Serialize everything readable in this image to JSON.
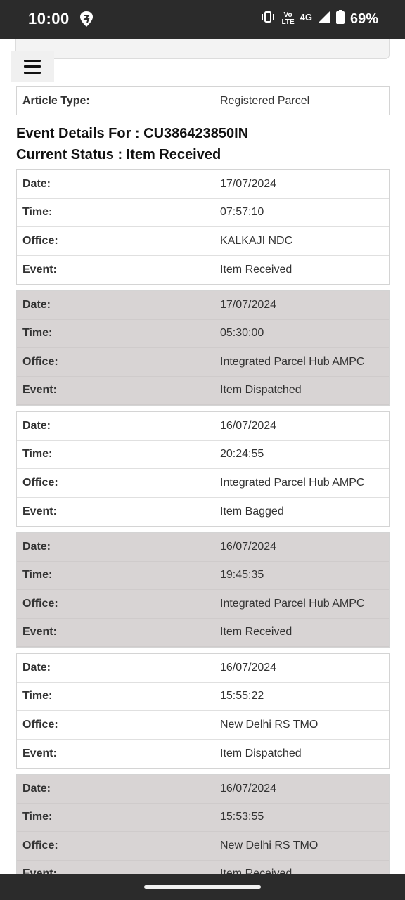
{
  "status_bar": {
    "time": "10:00",
    "app_icon": "swiggy-icon",
    "volte_line1": "Vo",
    "volte_line2": "LTE",
    "network": "4G",
    "battery": "69%"
  },
  "menu": {
    "icon": "hamburger-menu-icon"
  },
  "article": {
    "label": "Article Type:",
    "value": "Registered Parcel"
  },
  "heading": {
    "event_details": "Event Details For : CU386423850IN",
    "current_status": "Current Status : Item Received"
  },
  "labels": {
    "date": "Date:",
    "time": "Time:",
    "office": "Office:",
    "event": "Event:"
  },
  "events": [
    {
      "date": "17/07/2024",
      "time": "07:57:10",
      "office": "KALKAJI NDC",
      "event": "Item Received"
    },
    {
      "date": "17/07/2024",
      "time": "05:30:00",
      "office": "Integrated Parcel Hub AMPC",
      "event": "Item Dispatched"
    },
    {
      "date": "16/07/2024",
      "time": "20:24:55",
      "office": "Integrated Parcel Hub AMPC",
      "event": "Item Bagged"
    },
    {
      "date": "16/07/2024",
      "time": "19:45:35",
      "office": "Integrated Parcel Hub AMPC",
      "event": "Item Received"
    },
    {
      "date": "16/07/2024",
      "time": "15:55:22",
      "office": "New Delhi RS TMO",
      "event": "Item Dispatched"
    },
    {
      "date": "16/07/2024",
      "time": "15:53:55",
      "office": "New Delhi RS TMO",
      "event": "Item Received"
    }
  ]
}
